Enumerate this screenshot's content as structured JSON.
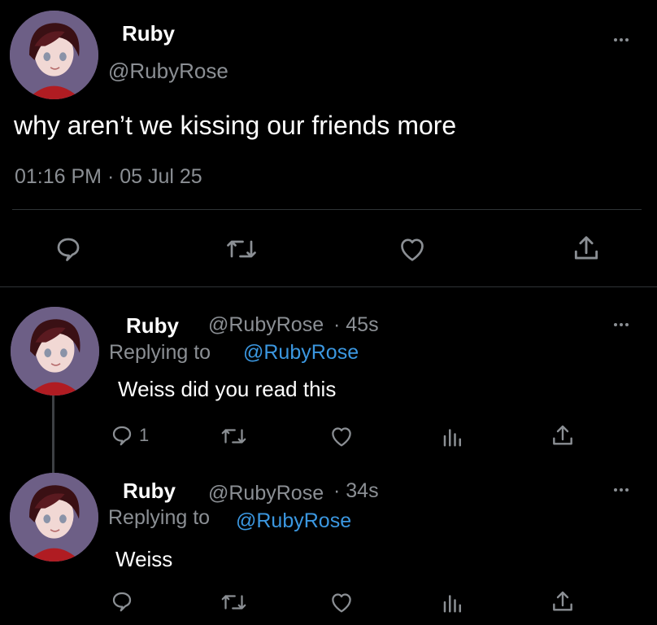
{
  "main_tweet": {
    "display_name": "Ruby",
    "handle": "@RubyRose",
    "text": "why aren’t we kissing our friends more",
    "timestamp": "01:16 PM · 05 Jul 25"
  },
  "replies": [
    {
      "display_name": "Ruby",
      "handle": "@RubyRose",
      "time": "· 45s",
      "replying_prefix": "Replying to",
      "replying_to": "@RubyRose",
      "text": "Weiss did you read this",
      "reply_count": "1"
    },
    {
      "display_name": "Ruby",
      "handle": "@RubyRose",
      "time": "· 34s",
      "replying_prefix": "Replying to",
      "replying_to": "@RubyRose",
      "text": "Weiss"
    }
  ],
  "icons": [
    "more-icon",
    "reply-icon",
    "retweet-icon",
    "like-icon",
    "analytics-icon",
    "share-icon",
    "avatar"
  ],
  "colors": {
    "background": "#000000",
    "muted": "#8b8f94",
    "link": "#3b97e0",
    "divider": "#2f3336"
  }
}
